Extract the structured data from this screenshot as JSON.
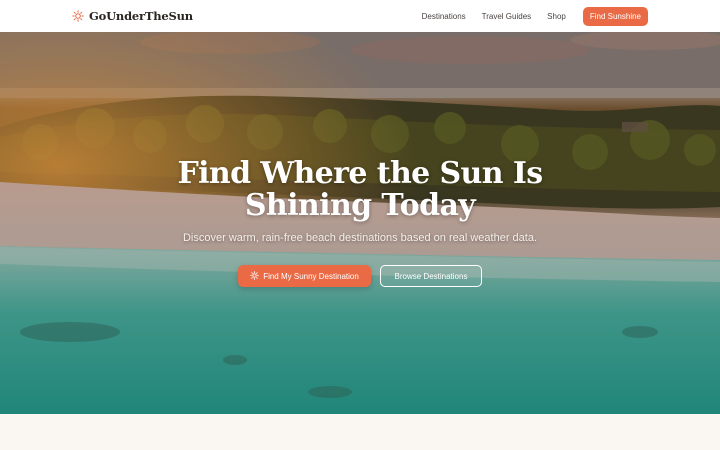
{
  "brand": {
    "name": "GoUnderTheSun",
    "icon": "sun-icon",
    "accent": "#ea6a45"
  },
  "nav": {
    "links": [
      "Destinations",
      "Travel Guides",
      "Shop"
    ],
    "cta_label": "Find Sunshine"
  },
  "hero": {
    "title_line1": "Find Where the Sun Is",
    "title_line2": "Shining Today",
    "subtitle": "Discover warm, rain-free beach destinations based on real weather data.",
    "primary_button": {
      "label": "Find My Sunny Destination",
      "icon": "sun-icon"
    },
    "secondary_button": {
      "label": "Browse Destinations"
    },
    "background": "tropical-beach-aerial-photo"
  }
}
